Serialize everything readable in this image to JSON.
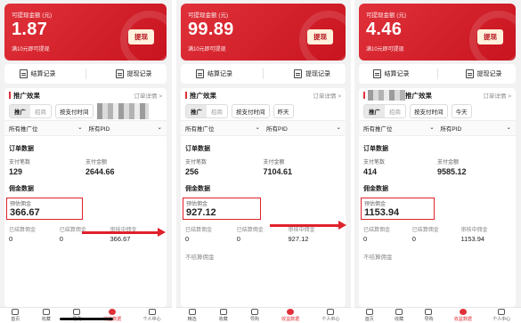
{
  "panels": [
    {
      "banner": {
        "caption": "可提现金额 (元)",
        "amount": "1.87",
        "note": "满10元即可提现",
        "withdraw": "提现"
      },
      "records": {
        "settle": "结算记录",
        "withdraw": "提现记录"
      },
      "promo": {
        "title": "推广效果",
        "detail_link": "订单详情 >"
      },
      "controls": {
        "seg_on": "推广",
        "seg_off": "招商",
        "time_type": "按支付时间"
      },
      "filters": {
        "position": "所有推广位",
        "pid": "所有PID"
      },
      "orders": {
        "title": "订单数据",
        "count_label": "支付笔数",
        "count": "129",
        "amount_label": "支付金额",
        "amount": "2644.66"
      },
      "commission": {
        "title": "佣金数据",
        "est_label": "预估佣金",
        "est": "366.67",
        "cols": [
          {
            "label": "已结算佣金",
            "value": "0"
          },
          {
            "label": "已结算佣金",
            "value": "0"
          },
          {
            "label": "审核中佣金",
            "value": "366.67"
          }
        ]
      },
      "nav": [
        "首页",
        "收藏",
        "导购",
        "收益数据",
        "个人中心"
      ]
    },
    {
      "banner": {
        "caption": "可提现金额 (元)",
        "amount": "99.89",
        "note": "满10元即可提现",
        "withdraw": "提现"
      },
      "records": {
        "settle": "结算记录",
        "withdraw": "提现记录"
      },
      "promo": {
        "title": "推广效果",
        "detail_link": "订单详情 >"
      },
      "controls": {
        "seg_on": "推广",
        "seg_off": "招商",
        "time_type": "按支付时间",
        "range": "昨天"
      },
      "filters": {
        "position": "所有推广位",
        "pid": "所有PID"
      },
      "orders": {
        "title": "订单数据",
        "count_label": "支付笔数",
        "count": "256",
        "amount_label": "支付金额",
        "amount": "7104.61"
      },
      "commission": {
        "title": "佣金数据",
        "est_label": "预估佣金",
        "est": "927.12",
        "cols": [
          {
            "label": "已结算佣金",
            "value": "0"
          },
          {
            "label": "已结算佣金",
            "value": "0"
          },
          {
            "label": "审核中佣金",
            "value": "927.12"
          }
        ]
      },
      "extra": "不结算佣金",
      "nav": [
        "精选",
        "收藏",
        "导购",
        "收益数据",
        "个人中心"
      ]
    },
    {
      "banner": {
        "caption": "可提现金额 (元)",
        "amount": "4.46",
        "note": "满10元即可提现",
        "withdraw": "提现"
      },
      "records": {
        "settle": "结算记录",
        "withdraw": "提现记录"
      },
      "promo": {
        "title": "推广效果",
        "detail_link": "订单详情 >"
      },
      "controls": {
        "seg_on": "推广",
        "seg_off": "招商",
        "time_type": "按支付时间",
        "range": "今天"
      },
      "filters": {
        "position": "所有推广位",
        "pid": "所有PID"
      },
      "orders": {
        "title": "订单数据",
        "count_label": "支付笔数",
        "count": "414",
        "amount_label": "支付金额",
        "amount": "9585.12"
      },
      "commission": {
        "title": "佣金数据",
        "est_label": "预估佣金",
        "est": "1153.94",
        "cols": [
          {
            "label": "已结算佣金",
            "value": "0"
          },
          {
            "label": "已结算佣金",
            "value": "0"
          },
          {
            "label": "审核中佣金",
            "value": "1153.94"
          }
        ]
      },
      "extra": "不结算佣金",
      "nav": [
        "首页",
        "收藏",
        "导购",
        "收益数据",
        "个人中心"
      ]
    }
  ],
  "colors": {
    "brand_red": "#e0313a",
    "highlight": "#e0202a"
  },
  "icons": [
    "document-icon",
    "withdraw-record-icon",
    "home-icon",
    "heart-icon",
    "guide-icon",
    "earnings-icon",
    "user-icon"
  ]
}
